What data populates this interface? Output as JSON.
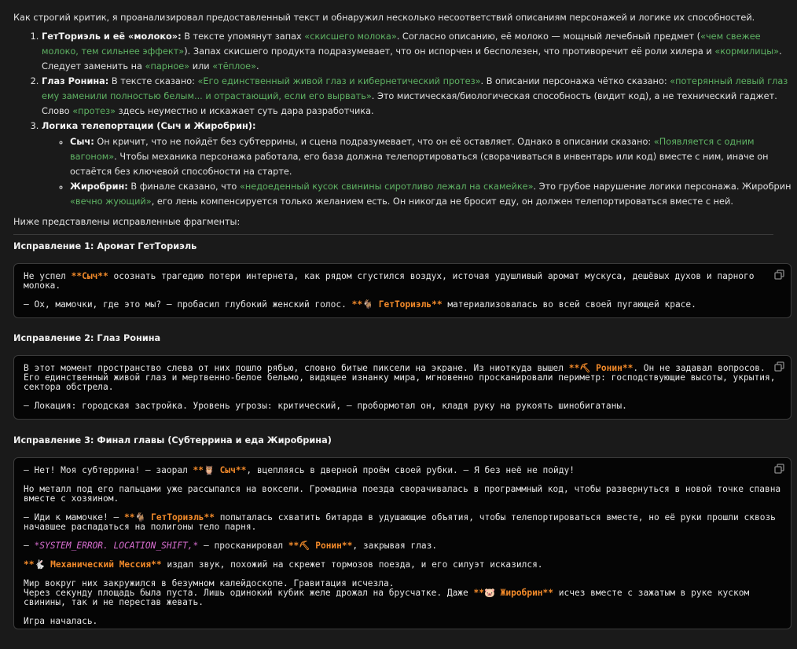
{
  "intro": "Как строгий критик, я проанализировал предоставленный текст и обнаружил несколько несоответствий описаниям персонажей и логике их способностей.",
  "issues": {
    "i1": {
      "title": "ГетТориэль и её «молоко»:",
      "t1": " В тексте упомянут запах ",
      "g1": "«скисшего молока»",
      "t2": ". Согласно описанию, её молоко — мощный лечебный предмет (",
      "g2": "«чем свежее молоко, тем сильнее эффект»",
      "t3": "). Запах скисшего продукта подразумевает, что он испорчен и бесполезен, что противоречит её роли хилера и ",
      "g3": "«кормилицы»",
      "t4": ". Следует заменить на ",
      "g4": "«парное»",
      "t5": " или ",
      "g5": "«тёплое»",
      "t6": "."
    },
    "i2": {
      "title": "Глаз Ронина:",
      "t1": " В тексте сказано: ",
      "g1": "«Его единственный живой глаз и кибернетический протез»",
      "t2": ". В описании персонажа чётко сказано: ",
      "g2": "«потерянный левый глаз ему заменили полностью белым... и отрастающий, если его вырвать»",
      "t3": ". Это мистическая/биологическая способность (видит код), а не технический гаджет. Слово ",
      "g3": "«протез»",
      "t4": " здесь неуместно и искажает суть дара разработчика."
    },
    "i3": {
      "title": "Логика телепортации (Сыч и Жиробрин):",
      "s1": {
        "name": "Сыч:",
        "t1": " Он кричит, что не пойдёт без субтеррины, и сцена подразумевает, что он её оставляет. Однако в описании сказано: ",
        "g1": "«Появляется с одним вагоном»",
        "t2": ". Чтобы механика персонажа работала, его база должна телепортироваться (сворачиваться в инвентарь или код) вместе с ним, иначе он остаётся без ключевой способности на старте."
      },
      "s2": {
        "name": "Жиробрин:",
        "t1": " В финале сказано, что ",
        "g1": "«недоеденный кусок свинины сиротливо лежал на скамейке»",
        "t2": ". Это грубое нарушение логики персонажа. Жиробрин ",
        "g2": "«вечно жующий»",
        "t3": ", его лень компенсируется только желанием есть. Он никогда не бросит еду, он должен телепортироваться вместе с ней."
      }
    }
  },
  "below": "Ниже представлены исправленные фрагменты:",
  "fix1": {
    "heading": "Исправление 1: Аромат ГетТориэль",
    "l1a": "Не успел ",
    "l1b": "**Сыч**",
    "l1c": " осознать трагедию потери интернета, как рядом сгустился воздух, источая удушливый аромат мускуса, дешёвых духов и парного молока.",
    "l2a": "— Ох, мамочки, где это мы? — пробасил глубокий женский голос. ",
    "l2b": "**🐐 ГетТориэль**",
    "l2c": " материализовалась во всей своей пугающей красе."
  },
  "fix2": {
    "heading": "Исправление 2: Глаз Ронина",
    "l1a": "В этот момент пространство слева от них пошло рябью, словно битые пиксели на экране. Из ниоткуда вышел ",
    "l1b": "**⛏ Ронин**",
    "l1c": ". Он не задавал вопросов. Его единственный живой глаз и мертвенно-белое бельмо, видящее изнанку мира, мгновенно просканировали периметр: господствующие высоты, укрытия, сектора обстрела.",
    "l2": "— Локация: городская застройка. Уровень угрозы: критический, — пробормотал он, кладя руку на рукоять шинобигатаны."
  },
  "fix3": {
    "heading": "Исправление 3: Финал главы (Субтеррина и еда Жиробрина)",
    "l1a": "— Нет! Моя субтеррина! — заорал ",
    "l1b": "**🦉 Сыч**",
    "l1c": ", вцепляясь в дверной проём своей рубки. — Я без неё не пойду!",
    "l2": "Но металл под его пальцами уже рассыпался на воксели. Громадина поезда сворачивалась в программный код, чтобы развернуться в новой точке спавна вместе с хозяином.",
    "l3a": "— Иди к мамочке! — ",
    "l3b": "**🐐 ГетТориэль**",
    "l3c": " попыталась схватить битарда в удушающие объятия, чтобы телепортироваться вместе, но её руки прошли сквозь начавшее распадаться на полигоны тело парня.",
    "l4a": "— ",
    "l4b": "*SYSTEM_ERROR. LOCATION_SHIFT,*",
    "l4c": " — просканировал ",
    "l4d": "**⛏ Ронин**",
    "l4e": ", закрывая глаз.",
    "l5a": "**🐇 Механический Мессия**",
    "l5b": " издал звук, похожий на скрежет тормозов поезда, и его силуэт исказился.",
    "l6": "Мир вокруг них закружился в безумном калейдоскопе. Гравитация исчезла.",
    "l7a": "Через секунду площадь была пуста. Лишь одинокий кубик желе дрожал на брусчатке. Даже ",
    "l7b": "**🐷 Жиробрин**",
    "l7c": " исчез вместе с зажатым в руке куском свинины, так и не перестав жевать.",
    "l8": "Игра началась."
  },
  "icons": {
    "copy": "copy-icon"
  }
}
